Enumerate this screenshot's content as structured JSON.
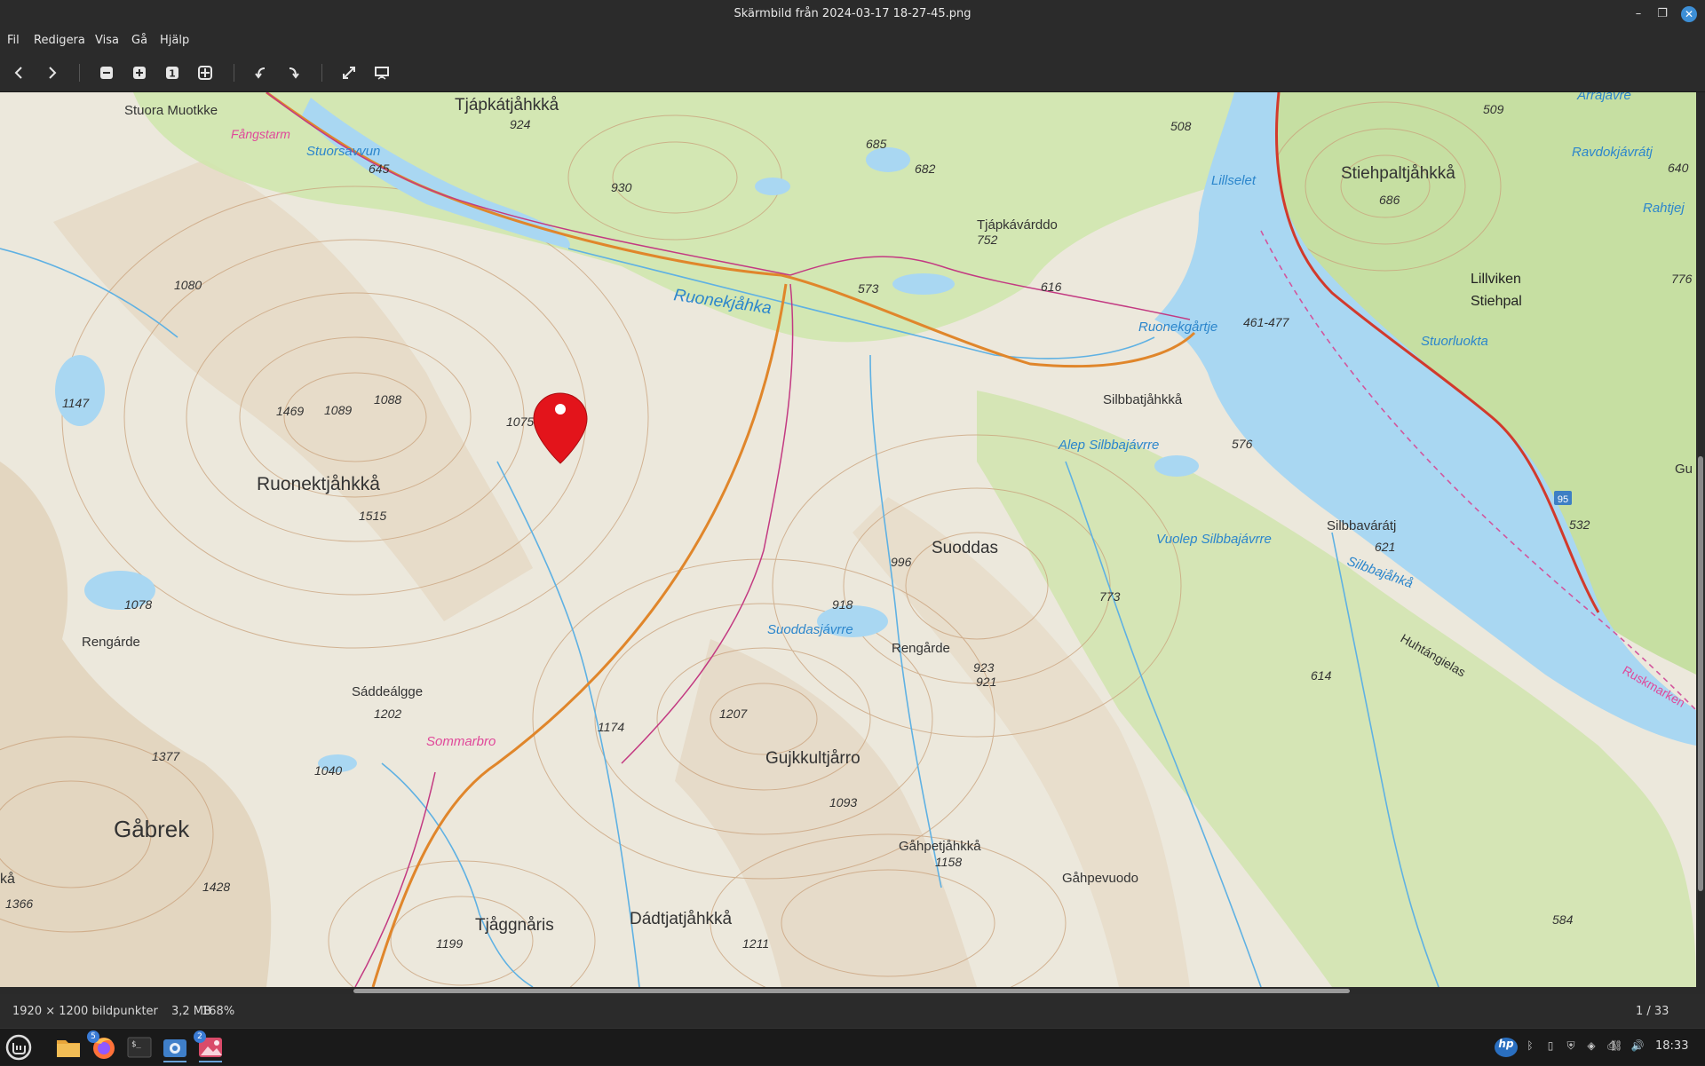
{
  "window": {
    "title": "Skärmbild från 2024-03-17 18-27-45.png",
    "minimize_icon": "minimize-icon",
    "maximize_icon": "maximize-icon",
    "close_icon": "close-icon"
  },
  "menu": {
    "items": [
      {
        "label": "Fil"
      },
      {
        "label": "Redigera"
      },
      {
        "label": "Visa"
      },
      {
        "label": "Gå"
      },
      {
        "label": "Hjälp"
      }
    ]
  },
  "toolbar": {
    "buttons": [
      {
        "name": "previous-image-button",
        "icon": "chevron-left-icon"
      },
      {
        "name": "next-image-button",
        "icon": "chevron-right-icon"
      },
      {
        "name": "zoom-out-button",
        "icon": "zoom-out-icon"
      },
      {
        "name": "zoom-in-button",
        "icon": "zoom-in-icon"
      },
      {
        "name": "zoom-normal-button",
        "icon": "zoom-100-icon",
        "label": "1"
      },
      {
        "name": "zoom-fit-button",
        "icon": "zoom-fit-icon"
      },
      {
        "name": "rotate-left-button",
        "icon": "rotate-left-icon"
      },
      {
        "name": "rotate-right-button",
        "icon": "rotate-right-icon"
      },
      {
        "name": "fullscreen-button",
        "icon": "fullscreen-icon"
      },
      {
        "name": "slideshow-button",
        "icon": "slideshow-icon"
      }
    ]
  },
  "map": {
    "labels": {
      "stuora_muotkke": "Stuora Muotkke",
      "fangstarm": "Fångstarm",
      "stuorsavvun": "Stuorsavvun",
      "tjapkatjahkka": "Tjápkátjåhkkå",
      "ruonekjahka": "Ruonekjåhka",
      "tjapkavarddo": "Tjápkávárddo",
      "lillselet": "Lillselet",
      "stiehpaltjahkka": "Stiehpaltjåhkkå",
      "ravdokjavratj": "Ravdokjávrátj",
      "rahtjej": "Rahtjej",
      "lillviken": "Lillviken",
      "stiehpal": "Stiehpal",
      "stuorluokta": "Stuorluokta",
      "ruonekgartje": "Ruonekgårtje",
      "silbbatjahkka": "Silbbatjåhkkå",
      "alep_silbbajavrre": "Alep Silbbajávrre",
      "ruonektjahkka": "Ruonektjåhkkå",
      "suoddas": "Suoddas",
      "vuolep_silbbajavrre": "Vuolep Silbbajávrre",
      "silbbavaratj": "Silbbavárátj",
      "silbbajahka": "Silbbajåhkå",
      "suoddasjavrre": "Suoddasjávrre",
      "rengarde1": "Rengárde",
      "rengarde2": "Rengårde",
      "saddealgge": "Sáddeálgge",
      "sommarbro": "Sommarbro",
      "gujkkultjarro": "Gujkkultjårro",
      "huhtangielas": "Huhtángielas",
      "gabrek": "Gåbrek",
      "ganpetjahkka": "Gåhpetjåhkkå",
      "gahpevuodo": "Gåhpevuodo",
      "tjaggnaris": "Tjåggnåris",
      "dadtjatjahkka": "Dádtjatjåhkkå",
      "arrajavrre": "Árrajávre",
      "ruskmarken": "Ruskmarken",
      "gu": "Gu",
      "ka": "kå",
      "road95": "95"
    },
    "elevations": {
      "e924": "924",
      "e645": "645",
      "e685": "685",
      "e682": "682",
      "e930": "930",
      "e508": "508",
      "e509": "509",
      "e640": "640",
      "e686": "686",
      "e752": "752",
      "e1080": "1080",
      "e573": "573",
      "e616": "616",
      "e461": "461-477",
      "e776": "776",
      "e1147": "1147",
      "e1469": "1469",
      "e1089": "1089",
      "e1088": "1088",
      "e1075": "1075",
      "e576": "576",
      "e1515": "1515",
      "e996": "996",
      "e621": "621",
      "e532": "532",
      "e1078": "1078",
      "e918": "918",
      "e773": "773",
      "e923": "923",
      "e921": "921",
      "e614": "614",
      "e1202": "1202",
      "e1207": "1207",
      "e1174": "1174",
      "e1377": "1377",
      "e1040": "1040",
      "e1093": "1093",
      "e1158": "1158",
      "e1428": "1428",
      "e1366": "1366",
      "e1199": "1199",
      "e1211": "1211",
      "e584": "584"
    },
    "marker_icon": "location-pin-icon"
  },
  "status": {
    "dimensions": "1920 × 1200 bildpunkter",
    "size": "3,2 MB",
    "zoom": "168%",
    "position": "1 / 33"
  },
  "taskbar": {
    "menu_icon": "mint-menu-icon",
    "apps": [
      {
        "name": "files-app",
        "icon": "folder-icon"
      },
      {
        "name": "firefox-app",
        "icon": "firefox-icon",
        "badge": "5"
      },
      {
        "name": "terminal-app",
        "icon": "terminal-icon"
      },
      {
        "name": "screenshot-app",
        "icon": "camera-icon"
      },
      {
        "name": "image-viewer-app",
        "icon": "image-viewer-icon",
        "badge": "2"
      }
    ],
    "clock": "18:33"
  },
  "colors": {
    "water": "#a9d7f2",
    "water_label": "#2c86cc",
    "forest": "#c7e3a3",
    "contour": "#c9a07a",
    "terrain": "#ece8dc",
    "road": "#e0862b",
    "trail": "#c33a82",
    "marker": "#e3141b"
  }
}
